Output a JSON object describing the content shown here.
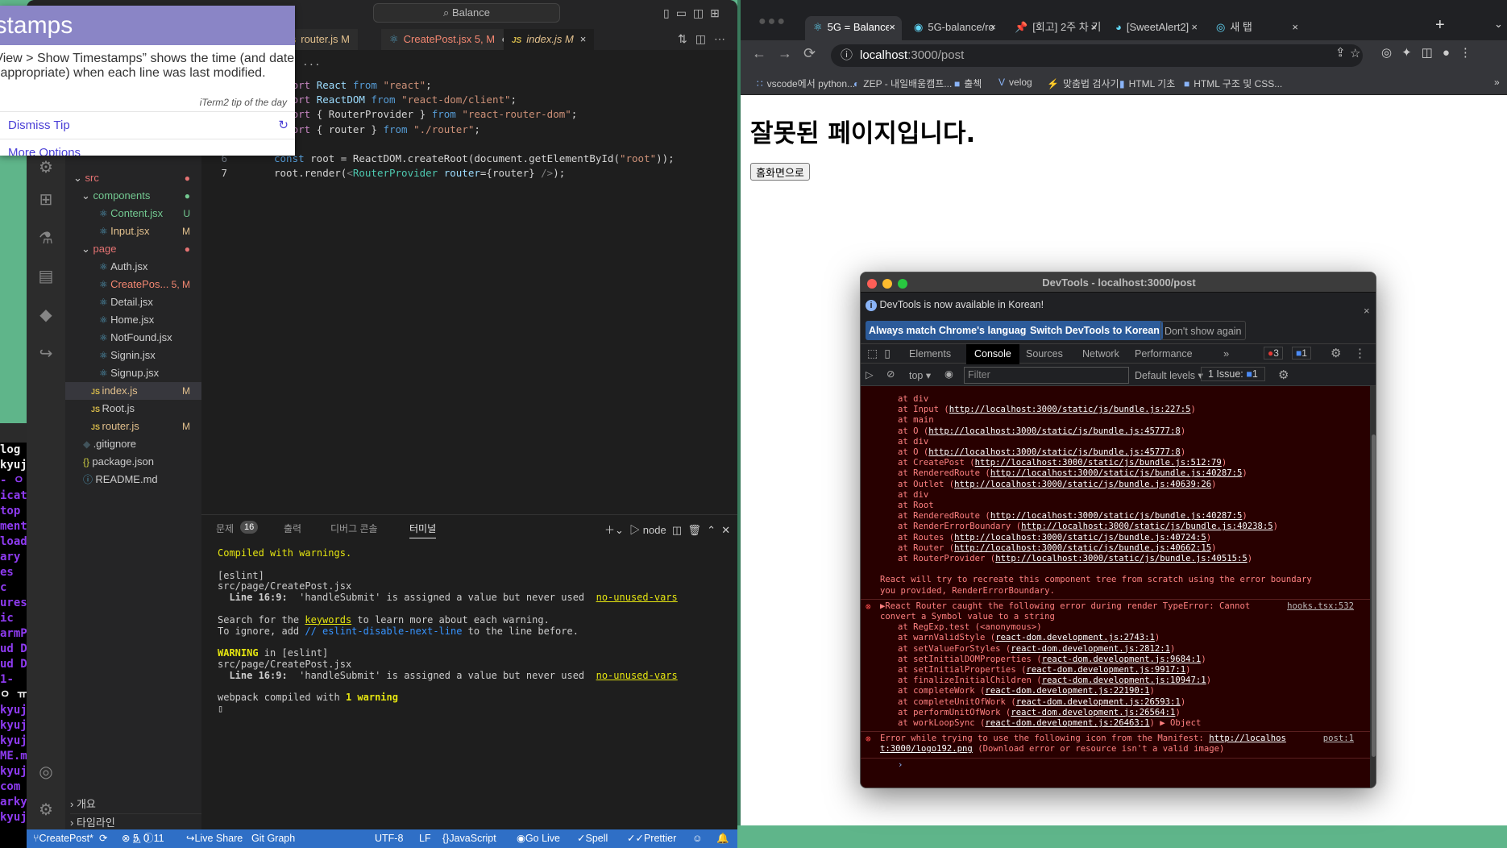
{
  "iterm": {
    "lines": [
      "log",
      "kyuj",
      "ㅇ -",
      "icat",
      "top",
      "ment",
      "load",
      "ary",
      "es",
      "c",
      "ures",
      "ic",
      "armP",
      "ud D",
      "ud D",
      "-1",
      "ㅇ ㅠ",
      "kyuj",
      "kyuj",
      "kyuj",
      "ME.m",
      "kyuj",
      " com",
      "arky",
      "kyuj"
    ]
  },
  "vscode": {
    "search": "Balance",
    "tabs": [
      {
        "label": "router.js",
        "status": "M",
        "icon": "js-icon"
      },
      {
        "label": "CreatePost.jsx",
        "status": "5, M",
        "icon": "react-icon",
        "dirty": "●"
      },
      {
        "label": "index.js",
        "status": "M",
        "icon": "js-icon",
        "close": "×"
      }
    ],
    "breadcrumb": "› ...",
    "code": [
      {
        "n": "1",
        "t": [
          [
            "#c586c0",
            "import "
          ],
          [
            "#9cdcfe",
            "React "
          ],
          [
            "#569cd6",
            "from "
          ],
          [
            "#ce9178",
            "\"react\""
          ],
          [
            "#d4d4d4",
            ";"
          ]
        ]
      },
      {
        "n": "2",
        "t": [
          [
            "#c586c0",
            "import "
          ],
          [
            "#9cdcfe",
            "ReactDOM "
          ],
          [
            "#569cd6",
            "from "
          ],
          [
            "#ce9178",
            "\"react-dom/client\""
          ],
          [
            "#d4d4d4",
            ";"
          ]
        ]
      },
      {
        "n": "3",
        "t": [
          [
            "#c586c0",
            "import "
          ],
          [
            "#d4d4d4",
            "{ RouterProvider } "
          ],
          [
            "#569cd6",
            "from "
          ],
          [
            "#ce9178",
            "\"react-router-dom\""
          ],
          [
            "#d4d4d4",
            ";"
          ]
        ]
      },
      {
        "n": "4",
        "t": [
          [
            "#c586c0",
            "import "
          ],
          [
            "#d4d4d4",
            "{ router } "
          ],
          [
            "#569cd6",
            "from "
          ],
          [
            "#ce9178",
            "\"./router\""
          ],
          [
            "#d4d4d4",
            ";"
          ]
        ]
      },
      {
        "n": "5",
        "t": []
      },
      {
        "n": "6",
        "t": [
          [
            "#569cd6",
            "const "
          ],
          [
            "#d4d4d4",
            "root = ReactDOM.createRoot(document.getElementById("
          ],
          [
            "#ce9178",
            "\"root\""
          ],
          [
            "#d4d4d4",
            "));"
          ]
        ]
      },
      {
        "n": "7",
        "t": [
          [
            "#d4d4d4",
            "root.render("
          ],
          [
            "#808080",
            "<"
          ],
          [
            "#4ec9b0",
            "RouterProvider "
          ],
          [
            "#9cdcfe",
            "router"
          ],
          [
            "#d4d4d4",
            "={router} "
          ],
          [
            "#808080",
            "/>"
          ],
          [
            "#d4d4d4",
            ");"
          ]
        ]
      }
    ],
    "explorer": [
      {
        "label": "src",
        "depth": 0,
        "folder": true,
        "color": "#e57373",
        "status": "●"
      },
      {
        "label": "components",
        "depth": 1,
        "folder": true,
        "color": "#73c991",
        "status": "●"
      },
      {
        "label": "Content.jsx",
        "depth": 2,
        "icon": "react-icon",
        "color": "#73c991",
        "status": "U"
      },
      {
        "label": "Input.jsx",
        "depth": 2,
        "icon": "react-icon",
        "color": "#e2c08d",
        "status": "M"
      },
      {
        "label": "page",
        "depth": 1,
        "folder": true,
        "color": "#e57373",
        "status": "●"
      },
      {
        "label": "Auth.jsx",
        "depth": 2,
        "icon": "react-icon",
        "color": "#ccc",
        "status": ""
      },
      {
        "label": "CreatePos...",
        "depth": 2,
        "icon": "react-icon",
        "color": "#f48771",
        "status": "5, M"
      },
      {
        "label": "Detail.jsx",
        "depth": 2,
        "icon": "react-icon",
        "color": "#ccc",
        "status": ""
      },
      {
        "label": "Home.jsx",
        "depth": 2,
        "icon": "react-icon",
        "color": "#ccc",
        "status": ""
      },
      {
        "label": "NotFound.jsx",
        "depth": 2,
        "icon": "react-icon",
        "color": "#ccc",
        "status": ""
      },
      {
        "label": "Signin.jsx",
        "depth": 2,
        "icon": "react-icon",
        "color": "#ccc",
        "status": ""
      },
      {
        "label": "Signup.jsx",
        "depth": 2,
        "icon": "react-icon",
        "color": "#ccc",
        "status": ""
      },
      {
        "label": "index.js",
        "depth": 1,
        "icon": "js-icon",
        "color": "#e2c08d",
        "status": "M",
        "selected": true
      },
      {
        "label": "Root.js",
        "depth": 1,
        "icon": "js-icon",
        "color": "#ccc",
        "status": ""
      },
      {
        "label": "router.js",
        "depth": 1,
        "icon": "js-icon",
        "color": "#e2c08d",
        "status": "M"
      },
      {
        "label": ".gitignore",
        "depth": 0,
        "icon": "git-icon",
        "color": "#ccc",
        "status": ""
      },
      {
        "label": "package.json",
        "depth": 0,
        "icon": "json-icon",
        "color": "#ccc",
        "status": ""
      },
      {
        "label": "README.md",
        "depth": 0,
        "icon": "info-icon",
        "color": "#ccc",
        "status": ""
      }
    ],
    "outline": "개요",
    "timeline": "타임라인",
    "panel": {
      "tabs": [
        "문제",
        "출력",
        "디버그 콘솔",
        "터미널"
      ],
      "problems_count": "16",
      "shell": "node",
      "terminal": [
        [
          [
            "#e5e510",
            "Compiled with warnings."
          ]
        ],
        [],
        [
          [
            "#ccc",
            "[eslint]"
          ]
        ],
        [
          [
            "#ccc",
            "src/page/CreatePost.jsx"
          ]
        ],
        [
          [
            "#ccc b",
            "  Line 16:9:"
          ],
          [
            "#ccc",
            "  'handleSubmit' is assigned a value but never used  "
          ],
          [
            "#e5e510 u",
            "no-unused-vars"
          ]
        ],
        [],
        [
          [
            "#ccc",
            "Search for the "
          ],
          [
            "#e5e510 u",
            "keywords"
          ],
          [
            "#ccc",
            " to learn more about each warning."
          ]
        ],
        [
          [
            "#ccc",
            "To ignore, add "
          ],
          [
            "#3794ff",
            "// eslint-disable-next-line"
          ],
          [
            "#ccc",
            " to the line before."
          ]
        ],
        [],
        [
          [
            "#e5e510 b",
            "WARNING"
          ],
          [
            "#ccc",
            " in [eslint]"
          ]
        ],
        [
          [
            "#ccc",
            "src/page/CreatePost.jsx"
          ]
        ],
        [
          [
            "#ccc b",
            "  Line 16:9:"
          ],
          [
            "#ccc",
            "  'handleSubmit' is assigned a value but never used  "
          ],
          [
            "#e5e510 u",
            "no-unused-vars"
          ]
        ],
        [],
        [
          [
            "#ccc",
            "webpack compiled with "
          ],
          [
            "#e5e510 b",
            "1 warning"
          ]
        ],
        [
          [
            "#ccc",
            "▯"
          ]
        ]
      ]
    },
    "status": {
      "branch": "CreatePost*",
      "errors": "5",
      "warnings": "0",
      "info": "11",
      "live_share": "Live Share",
      "git_graph": "Git Graph",
      "encoding": "UTF-8",
      "eol": "LF",
      "language": "JavaScript",
      "go_live": "Go Live",
      "spell": "Spell",
      "prettier": "Prettier"
    },
    "colors": {
      "status_bar": "#2f6fc6"
    }
  },
  "tip": {
    "title": "Timestamps",
    "body": "“View > Show Timestamps” shows the time (and date,\nif appropriate) when each line was last modified.",
    "source": "iTerm2 tip of the day",
    "dismiss": "Dismiss Tip",
    "more": "More Options"
  },
  "chrome": {
    "tabs": [
      "5G = Balance",
      "5G-balance/ro",
      "[회고] 2주 차 기",
      "[SweetAlert2]",
      "새 탭"
    ],
    "url_host": "localhost",
    "url_path": ":3000/post",
    "bookmarks": [
      "vscode에서 python...",
      "ZEP - 내일배움캠프...",
      "출첵",
      "velog",
      "맞춤법 검사기",
      "HTML 기초",
      "HTML 구조 및 CSS..."
    ],
    "page": {
      "heading": "잘못된 페이지입니다.",
      "button": "홈화면으로"
    }
  },
  "devtools": {
    "title": "DevTools - localhost:3000/post",
    "info": "DevTools is now available in Korean!",
    "buttons": [
      "Always match Chrome's language",
      "Switch DevTools to Korean",
      "Don't show again"
    ],
    "tabs": [
      "Elements",
      "Console",
      "Sources",
      "Network",
      "Performance"
    ],
    "error_count": "3",
    "message_count": "1",
    "context": "top",
    "filter_placeholder": "Filter",
    "levels": "Default levels",
    "issues": "1 Issue:",
    "issues_count": "1",
    "console": [
      {
        "p": "at div"
      },
      {
        "p": "at Input (",
        "l": "http://localhost:3000/static/js/bundle.js:227:5",
        "s": ")"
      },
      {
        "p": "at main"
      },
      {
        "p": "at O (",
        "l": "http://localhost:3000/static/js/bundle.js:45777:8",
        "s": ")"
      },
      {
        "p": "at div"
      },
      {
        "p": "at O (",
        "l": "http://localhost:3000/static/js/bundle.js:45777:8",
        "s": ")"
      },
      {
        "p": "at CreatePost (",
        "l": "http://localhost:3000/static/js/bundle.js:512:79",
        "s": ")"
      },
      {
        "p": "at RenderedRoute (",
        "l": "http://localhost:3000/static/js/bundle.js:40287:5",
        "s": ")"
      },
      {
        "p": "at Outlet (",
        "l": "http://localhost:3000/static/js/bundle.js:40639:26",
        "s": ")"
      },
      {
        "p": "at div"
      },
      {
        "p": "at Root"
      },
      {
        "p": "at RenderedRoute (",
        "l": "http://localhost:3000/static/js/bundle.js:40287:5",
        "s": ")"
      },
      {
        "p": "at RenderErrorBoundary (",
        "l": "http://localhost:3000/static/js/bundle.js:40238:5",
        "s": ")"
      },
      {
        "p": "at Routes (",
        "l": "http://localhost:3000/static/js/bundle.js:40724:5",
        "s": ")"
      },
      {
        "p": "at Router (",
        "l": "http://localhost:3000/static/js/bundle.js:40662:15",
        "s": ")"
      },
      {
        "p": "at RouterProvider (",
        "l": "http://localhost:3000/static/js/bundle.js:40515:5",
        "s": ")"
      },
      {
        "p": ""
      },
      {
        "p": "React will try to recreate this component tree from scratch using the error boundary",
        "top": true
      },
      {
        "p": "you provided, RenderErrorBoundary.",
        "top": true
      },
      {
        "sep": true
      },
      {
        "p": "▶React Router caught the following error during render TypeError: Cannot",
        "top": true,
        "err": true,
        "src": "hooks.tsx:532"
      },
      {
        "p": "convert a Symbol value to a string",
        "top": true
      },
      {
        "p": "at RegExp.test (<anonymous>)"
      },
      {
        "p": "at warnValidStyle (",
        "l": "react-dom.development.js:2743:1",
        "s": ")"
      },
      {
        "p": "at setValueForStyles (",
        "l": "react-dom.development.js:2812:1",
        "s": ")"
      },
      {
        "p": "at setInitialDOMProperties (",
        "l": "react-dom.development.js:9684:1",
        "s": ")"
      },
      {
        "p": "at setInitialProperties (",
        "l": "react-dom.development.js:9917:1",
        "s": ")"
      },
      {
        "p": "at finalizeInitialChildren (",
        "l": "react-dom.development.js:10947:1",
        "s": ")"
      },
      {
        "p": "at completeWork (",
        "l": "react-dom.development.js:22190:1",
        "s": ")"
      },
      {
        "p": "at completeUnitOfWork (",
        "l": "react-dom.development.js:26593:1",
        "s": ")"
      },
      {
        "p": "at performUnitOfWork (",
        "l": "react-dom.development.js:26564:1",
        "s": ")"
      },
      {
        "p": "at workLoopSync (",
        "l": "react-dom.development.js:26463:1",
        "s": ") ▶ Object"
      },
      {
        "sep": true
      },
      {
        "p": "Error while trying to use the following icon from the Manifest: ",
        "l": "http://localhos",
        "top": true,
        "err": true,
        "src": "post:1"
      },
      {
        "l": "t:3000/logo192.png",
        "s": " (Download error or resource isn't a valid image)",
        "top": true
      },
      {
        "sep": true
      },
      {
        "p": "›",
        "prompt": true
      }
    ]
  }
}
